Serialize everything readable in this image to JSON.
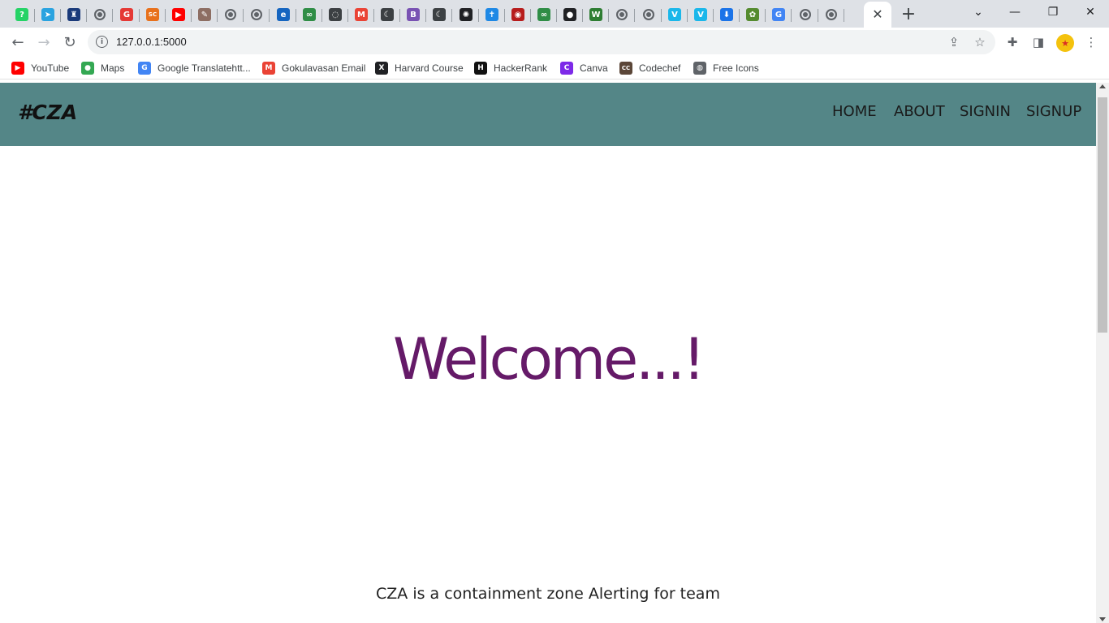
{
  "browser": {
    "tabs": [
      {
        "icon": "whatsapp-icon",
        "color": "#25d366",
        "glyph": "?"
      },
      {
        "icon": "telegram-icon",
        "color": "#2aa3e0",
        "glyph": "➤"
      },
      {
        "icon": "figure-icon",
        "color": "#1a3a7a",
        "glyph": "♜"
      },
      {
        "icon": "globe-icon",
        "color": "#5f6368",
        "glyph": ""
      },
      {
        "icon": "grammarly-icon",
        "color": "#e53935",
        "glyph": "G"
      },
      {
        "icon": "sc-icon",
        "color": "#e8711c",
        "glyph": "SC"
      },
      {
        "icon": "youtube-icon",
        "color": "#ff0000",
        "glyph": "▶"
      },
      {
        "icon": "document-icon",
        "color": "#8d6e63",
        "glyph": "✎"
      },
      {
        "icon": "globe-icon",
        "color": "#5f6368",
        "glyph": ""
      },
      {
        "icon": "globe-icon",
        "color": "#5f6368",
        "glyph": ""
      },
      {
        "icon": "edge-icon",
        "color": "#1565c0",
        "glyph": "e"
      },
      {
        "icon": "geeksforgeeks-icon",
        "color": "#2f8d46",
        "glyph": "∞"
      },
      {
        "icon": "loop-icon",
        "color": "#3c4043",
        "glyph": "◌"
      },
      {
        "icon": "gmail-icon",
        "color": "#ea4335",
        "glyph": "M"
      },
      {
        "icon": "moon-icon",
        "color": "#3c4043",
        "glyph": "☾"
      },
      {
        "icon": "bootstrap-icon",
        "color": "#7952b3",
        "glyph": "B"
      },
      {
        "icon": "moon-icon",
        "color": "#3c4043",
        "glyph": "☾"
      },
      {
        "icon": "openai-icon",
        "color": "#202124",
        "glyph": "✺"
      },
      {
        "icon": "cross-icon",
        "color": "#1e88e5",
        "glyph": "✝"
      },
      {
        "icon": "emblem-icon",
        "color": "#b71c1c",
        "glyph": "◉"
      },
      {
        "icon": "geeksforgeeks-icon",
        "color": "#2f8d46",
        "glyph": "∞"
      },
      {
        "icon": "github-icon",
        "color": "#202124",
        "glyph": "●"
      },
      {
        "icon": "w-icon",
        "color": "#2e7d32",
        "glyph": "W"
      },
      {
        "icon": "globe-icon",
        "color": "#5f6368",
        "glyph": ""
      },
      {
        "icon": "globe-icon",
        "color": "#5f6368",
        "glyph": ""
      },
      {
        "icon": "vimeo-icon",
        "color": "#1ab7ea",
        "glyph": "V"
      },
      {
        "icon": "vimeo-icon",
        "color": "#1ab7ea",
        "glyph": "V"
      },
      {
        "icon": "download-icon",
        "color": "#1a73e8",
        "glyph": "⬇"
      },
      {
        "icon": "palm-icon",
        "color": "#558b2f",
        "glyph": "✿"
      },
      {
        "icon": "google-icon",
        "color": "#4285f4",
        "glyph": "G"
      },
      {
        "icon": "globe-icon",
        "color": "#5f6368",
        "glyph": ""
      },
      {
        "icon": "globe-icon",
        "color": "#5f6368",
        "glyph": ""
      }
    ],
    "active_tab_close": "✕",
    "new_tab": "+",
    "address_url": "127.0.0.1:5000",
    "window_controls": {
      "dropdown": "⌄",
      "minimize": "—",
      "restore": "❐",
      "close": "✕"
    }
  },
  "bookmarks": [
    {
      "label": "YouTube",
      "icon": "youtube-icon",
      "color": "#ff0000",
      "glyph": "▶"
    },
    {
      "label": "Maps",
      "icon": "maps-pin-icon",
      "color": "#34a853",
      "glyph": "●"
    },
    {
      "label": "Google Translatehtt...",
      "icon": "google-translate-icon",
      "color": "#4285f4",
      "glyph": "G"
    },
    {
      "label": "Gokulavasan Email",
      "icon": "gmail-icon",
      "color": "#ea4335",
      "glyph": "M"
    },
    {
      "label": "Harvard Course",
      "icon": "edx-icon",
      "color": "#202124",
      "glyph": "X"
    },
    {
      "label": "HackerRank",
      "icon": "hackerrank-icon",
      "color": "#111111",
      "glyph": "H"
    },
    {
      "label": "Canva",
      "icon": "canva-icon",
      "color": "#7d2ae8",
      "glyph": "C"
    },
    {
      "label": "Codechef",
      "icon": "codechef-icon",
      "color": "#5b4638",
      "glyph": "CC"
    },
    {
      "label": "Free Icons",
      "icon": "globe-icon",
      "color": "#5f6368",
      "glyph": "◍"
    }
  ],
  "site": {
    "brand": "#CZA",
    "nav": [
      "HOME",
      "ABOUT",
      "SIGNIN",
      "SIGNUP"
    ],
    "nav_color": "#548687",
    "heading": "Welcome...!",
    "heading_color": "#651a68",
    "tagline": "CZA is a containment zone Alerting for team"
  }
}
